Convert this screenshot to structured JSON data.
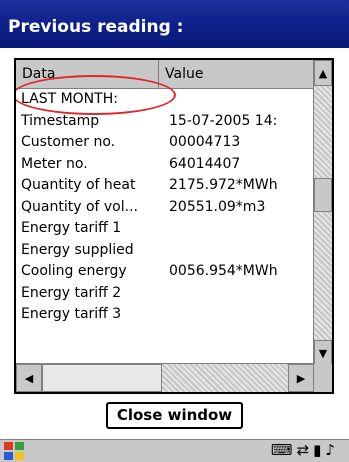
{
  "window": {
    "title": "Previous reading :"
  },
  "list": {
    "columns": [
      "Data",
      "Value"
    ],
    "rows": [
      {
        "data": "LAST MONTH:",
        "value": ""
      },
      {
        "data": "Timestamp",
        "value": "15-07-2005 14:"
      },
      {
        "data": "Customer no.",
        "value": "00004713"
      },
      {
        "data": "Meter no.",
        "value": "64014407"
      },
      {
        "data": "Quantity of heat",
        "value": "2175.972*MWh"
      },
      {
        "data": "Quantity of vol...",
        "value": "20551.09*m3"
      },
      {
        "data": "Energy tariff 1",
        "value": ""
      },
      {
        "data": "Energy supplied",
        "value": ""
      },
      {
        "data": "Cooling energy",
        "value": "0056.954*MWh"
      },
      {
        "data": "Energy tariff 2",
        "value": ""
      },
      {
        "data": "Energy tariff 3",
        "value": ""
      }
    ]
  },
  "buttons": {
    "close": "Close window"
  },
  "colors": {
    "titlebar": "#0d1f86",
    "annotation_circle": "#e0282c"
  }
}
